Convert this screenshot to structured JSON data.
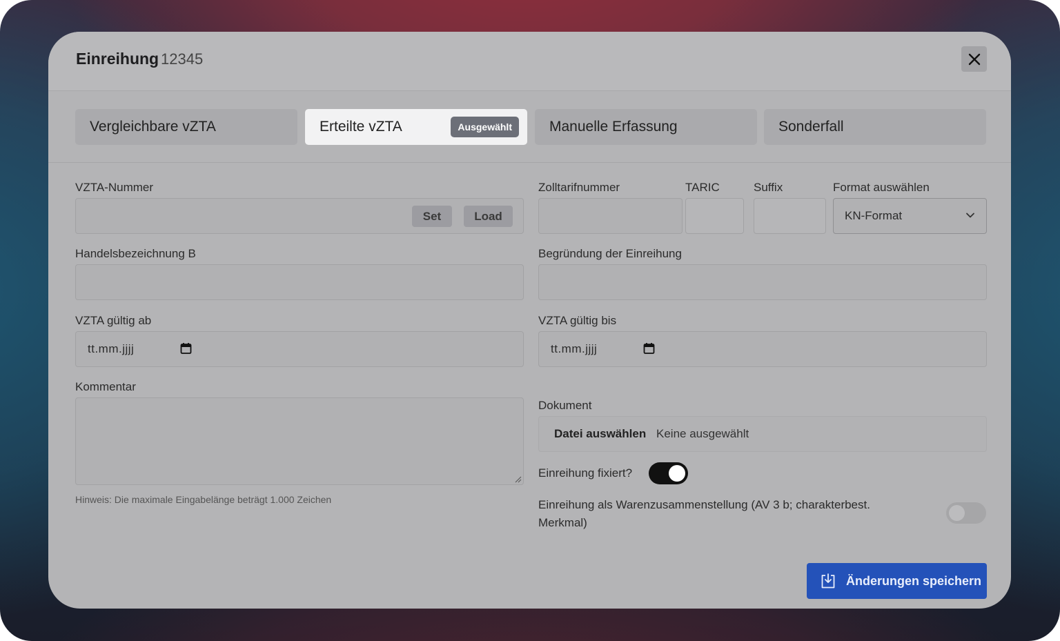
{
  "modal": {
    "title": "Einreihung",
    "id": "12345"
  },
  "tabs": [
    {
      "label": "Vergleichbare vZTA",
      "selected": false
    },
    {
      "label": "Erteilte vZTA",
      "selected": true,
      "badge": "Ausgewählt"
    },
    {
      "label": "Manuelle Erfassung",
      "selected": false
    },
    {
      "label": "Sonderfall",
      "selected": false
    }
  ],
  "form": {
    "vzta_nummer": {
      "label": "VZTA-Nummer",
      "value": "",
      "set_label": "Set",
      "load_label": "Load"
    },
    "zolltarifnummer": {
      "label": "Zolltarifnummer",
      "value": ""
    },
    "taric": {
      "label": "TARIC",
      "value": ""
    },
    "suffix": {
      "label": "Suffix",
      "value": ""
    },
    "format": {
      "label": "Format auswählen",
      "value": "KN-Format"
    },
    "handelsbezeichnung": {
      "label": "Handelsbezeichnung B",
      "value": ""
    },
    "begruendung": {
      "label": "Begründung der Einreihung",
      "value": ""
    },
    "gueltig_ab": {
      "label": "VZTA gültig ab",
      "placeholder": "tt.mm.jjjj"
    },
    "gueltig_bis": {
      "label": "VZTA gültig bis",
      "placeholder": "tt.mm.jjjj"
    },
    "kommentar": {
      "label": "Kommentar",
      "value": "",
      "hint": "Hinweis: Die maximale Eingabelänge beträgt 1.000 Zeichen"
    },
    "dokument": {
      "label": "Dokument",
      "button": "Datei auswählen",
      "status": "Keine ausgewählt"
    },
    "fixiert": {
      "label": "Einreihung fixiert?",
      "on": true
    },
    "warenzusammenstellung": {
      "label_line1": "Einreihung als Warenzusammenstellung (AV 3 b; charakterbest.",
      "label_line2": "Merkmal)",
      "on": false
    }
  },
  "footer": {
    "save_label": "Änderungen speichern"
  },
  "colors": {
    "accent": "#2452b9",
    "badge": "#6c6f78",
    "toggle_on": "#111111"
  }
}
